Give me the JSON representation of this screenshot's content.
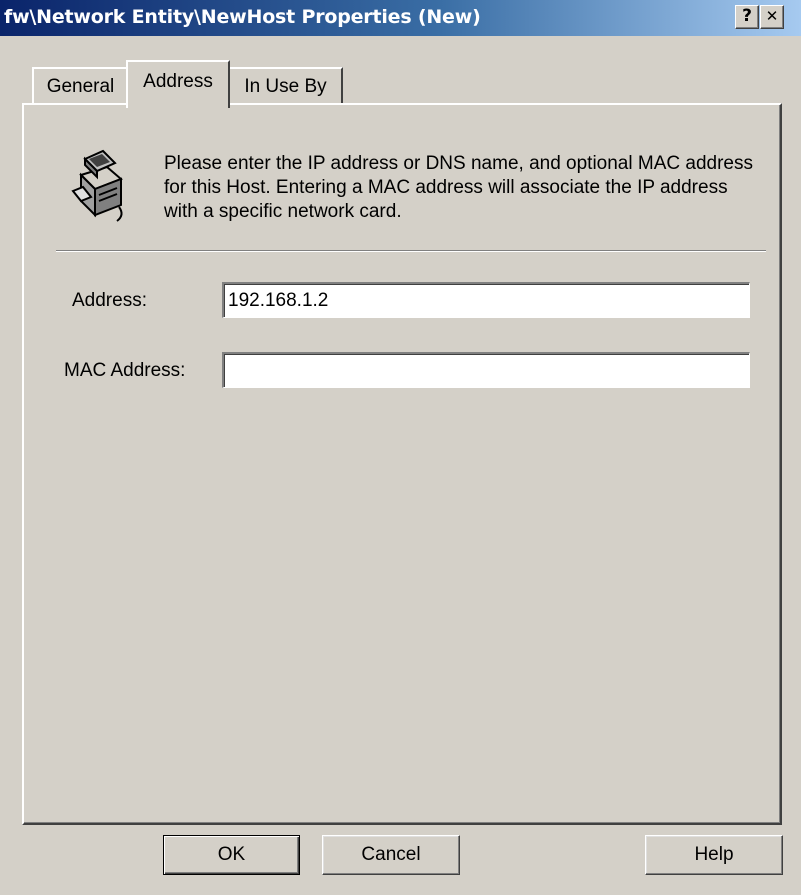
{
  "window": {
    "title": "fw\\Network Entity\\NewHost Properties (New)",
    "help_glyph": "?",
    "close_glyph": "✕",
    "colors": {
      "titlebar_start": "#0a246a",
      "titlebar_end": "#a6caf0",
      "face": "#d4d0c8"
    }
  },
  "tabs": [
    {
      "label": "General",
      "active": false
    },
    {
      "label": "Address",
      "active": true
    },
    {
      "label": "In Use By",
      "active": false
    }
  ],
  "address_page": {
    "icon": "host-computer-icon",
    "intro": "Please enter the IP address or DNS name, and optional MAC address for this Host. Entering a MAC address will associate the IP address with a specific network card.",
    "address_label": "Address:",
    "address_value": "192.168.1.2",
    "mac_label": "MAC Address:",
    "mac_value": ""
  },
  "buttons": {
    "ok": "OK",
    "cancel": "Cancel",
    "help": "Help"
  }
}
